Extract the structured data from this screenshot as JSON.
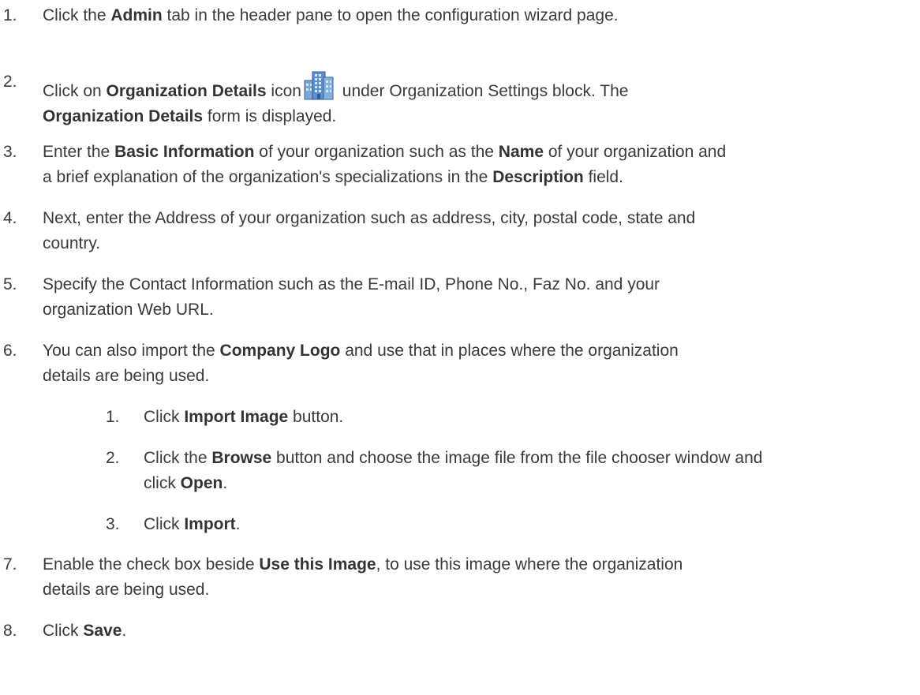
{
  "steps": [
    {
      "num": "1.",
      "parts": [
        "Click the ",
        "Admin",
        " tab in the header pane to open the configuration wizard page."
      ]
    },
    {
      "num": "2.",
      "parts": [
        "Click on ",
        "Organization Details",
        " icon",
        "",
        " under Organization Settings block. The",
        "Organization Details",
        " form is displayed."
      ],
      "icon": "building-icon"
    },
    {
      "num": "3.",
      "parts": [
        "Enter the ",
        "Basic Information",
        " of your organization such as the ",
        "Name",
        " of your organization and",
        "a brief explanation of the organization's specializations in the ",
        "Description",
        " field."
      ]
    },
    {
      "num": "4.",
      "parts": [
        "Next, enter the Address of your organization such as address, city, postal code, state and",
        "country."
      ]
    },
    {
      "num": "5.",
      "parts": [
        "Specify the Contact Information such as the E-mail ID, Phone No., Faz No. and your",
        "organization Web URL."
      ]
    },
    {
      "num": "6.",
      "parts": [
        "You can also import the ",
        "Company Logo",
        " and use that in places where the organization",
        "details are being used."
      ]
    },
    {
      "num": "1.",
      "parts": [
        "Click ",
        "Import Image",
        " button."
      ]
    },
    {
      "num": "2.",
      "parts": [
        "Click the ",
        "Browse",
        " button and choose the image file from the file chooser window and",
        "click ",
        "Open",
        "."
      ]
    },
    {
      "num": "3.",
      "parts": [
        "Click ",
        "Import",
        "."
      ]
    },
    {
      "num": "7.",
      "parts": [
        "Enable the check box beside ",
        "Use this Image",
        ", to use this image where the organization",
        "details are being used."
      ]
    },
    {
      "num": "8.",
      "parts": [
        "Click ",
        "Save",
        "."
      ]
    }
  ],
  "colors": {
    "text": "#3a3a3a",
    "icon_blue": "#4a7fc1"
  }
}
